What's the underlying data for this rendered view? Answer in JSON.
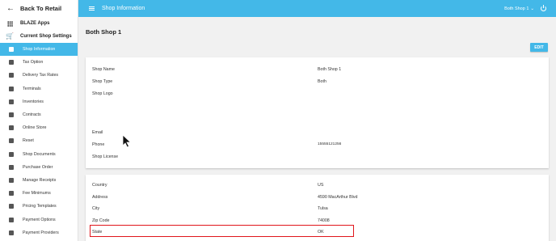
{
  "sidebar": {
    "back_label": "Back To Retail",
    "apps_label": "BLAZE Apps",
    "settings_label": "Current Shop Settings",
    "items": [
      {
        "label": "Shop Information",
        "icon": "store-icon"
      },
      {
        "label": "Tax Option",
        "icon": "cart-icon"
      },
      {
        "label": "Delivery Tax Rates",
        "icon": "cart-off-icon"
      },
      {
        "label": "Terminals",
        "icon": "briefcase-icon"
      },
      {
        "label": "Inventories",
        "icon": "inventory-icon"
      },
      {
        "label": "Contracts",
        "icon": "contract-icon"
      },
      {
        "label": "Online Store",
        "icon": "cart-icon"
      },
      {
        "label": "Reset",
        "icon": "refresh-icon"
      },
      {
        "label": "Shop Documents",
        "icon": "document-icon"
      },
      {
        "label": "Purchase Order",
        "icon": "list-icon"
      },
      {
        "label": "Manage Receipts",
        "icon": "receipt-icon"
      },
      {
        "label": "Fee Minimums",
        "icon": "dollar-icon"
      },
      {
        "label": "Pricing Templates",
        "icon": "list-icon"
      },
      {
        "label": "Payment Options",
        "icon": "card-icon"
      },
      {
        "label": "Payment Providers",
        "icon": "card-icon"
      }
    ]
  },
  "header": {
    "title": "Shop Information",
    "shop_selector": "Both Shop 1"
  },
  "main": {
    "page_title": "Both Shop 1",
    "edit_label": "EDIT",
    "card1": [
      {
        "label": "Shop Name",
        "value": "Both Shop 1"
      },
      {
        "label": "Shop Type",
        "value": "Both"
      },
      {
        "label": "Shop Logo",
        "value": ""
      },
      {
        "label": "Email",
        "value": ""
      },
      {
        "label": "Phone",
        "value": "15555121256"
      },
      {
        "label": "Shop License",
        "value": ""
      }
    ],
    "card2": [
      {
        "label": "Country",
        "value": "US"
      },
      {
        "label": "Address",
        "value": "4590 MacArthur Blvd"
      },
      {
        "label": "City",
        "value": "Tulsa"
      },
      {
        "label": "Zip Code",
        "value": "74008"
      },
      {
        "label": "State",
        "value": "OK"
      }
    ]
  },
  "colors": {
    "accent": "#43b8e8",
    "highlight": "#e0161c"
  }
}
